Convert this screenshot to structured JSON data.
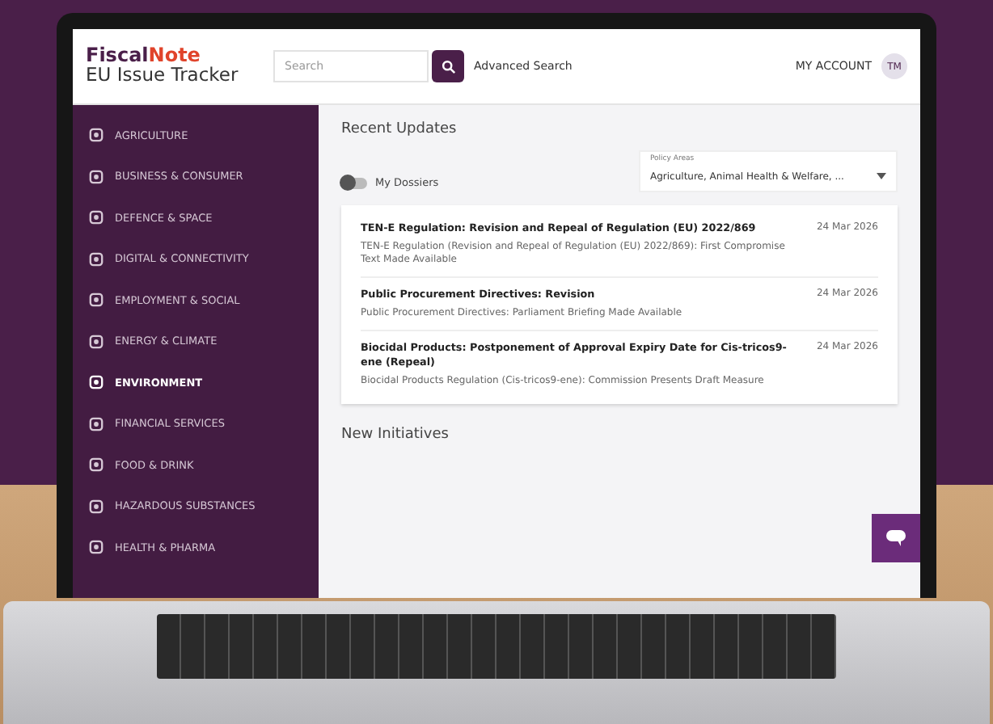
{
  "header": {
    "brand_primary": "Fiscal",
    "brand_accent": "Note",
    "product": "EU Issue Tracker",
    "search": {
      "placeholder": "Search"
    },
    "advanced_search": "Advanced Search",
    "account": "MY ACCOUNT",
    "avatar_initials": "TM"
  },
  "sidebar": {
    "items": [
      {
        "label": "AGRICULTURE",
        "selected": false
      },
      {
        "label": "BUSINESS & CONSUMER",
        "selected": false
      },
      {
        "label": "DEFENCE & SPACE",
        "selected": false
      },
      {
        "label": "DIGITAL & CONNECTIVITY",
        "selected": false
      },
      {
        "label": "EMPLOYMENT & SOCIAL",
        "selected": false
      },
      {
        "label": "ENERGY & CLIMATE",
        "selected": false
      },
      {
        "label": "ENVIRONMENT",
        "selected": true
      },
      {
        "label": "FINANCIAL SERVICES",
        "selected": false
      },
      {
        "label": "FOOD & DRINK",
        "selected": false
      },
      {
        "label": "HAZARDOUS SUBSTANCES",
        "selected": false
      },
      {
        "label": "HEALTH & PHARMA",
        "selected": false
      }
    ]
  },
  "main": {
    "heading": "Recent Updates",
    "toggle": {
      "label": "My Dossiers",
      "on": false
    },
    "policy_select": {
      "label": "Policy Areas",
      "value": "Agriculture, Animal Health & Welfare, ..."
    },
    "updates": [
      {
        "title": "TEN-E Regulation: Revision and Repeal of Regulation (EU) 2022/869",
        "date": "24 Mar 2026",
        "summary": "TEN-E Regulation (Revision and Repeal of Regulation (EU) 2022/869): First Compromise Text Made Available"
      },
      {
        "title": "Public Procurement Directives: Revision",
        "date": "24 Mar 2026",
        "summary": "Public Procurement Directives: Parliament Briefing Made Available"
      },
      {
        "title": "Biocidal Products: Postponement of Approval Expiry Date for Cis-tricos9-ene (Repeal)",
        "date": "24 Mar 2026",
        "summary": "Biocidal Products Regulation (Cis-tricos9-ene): Commission Presents Draft Measure"
      }
    ],
    "next_heading": "New Initiatives"
  }
}
